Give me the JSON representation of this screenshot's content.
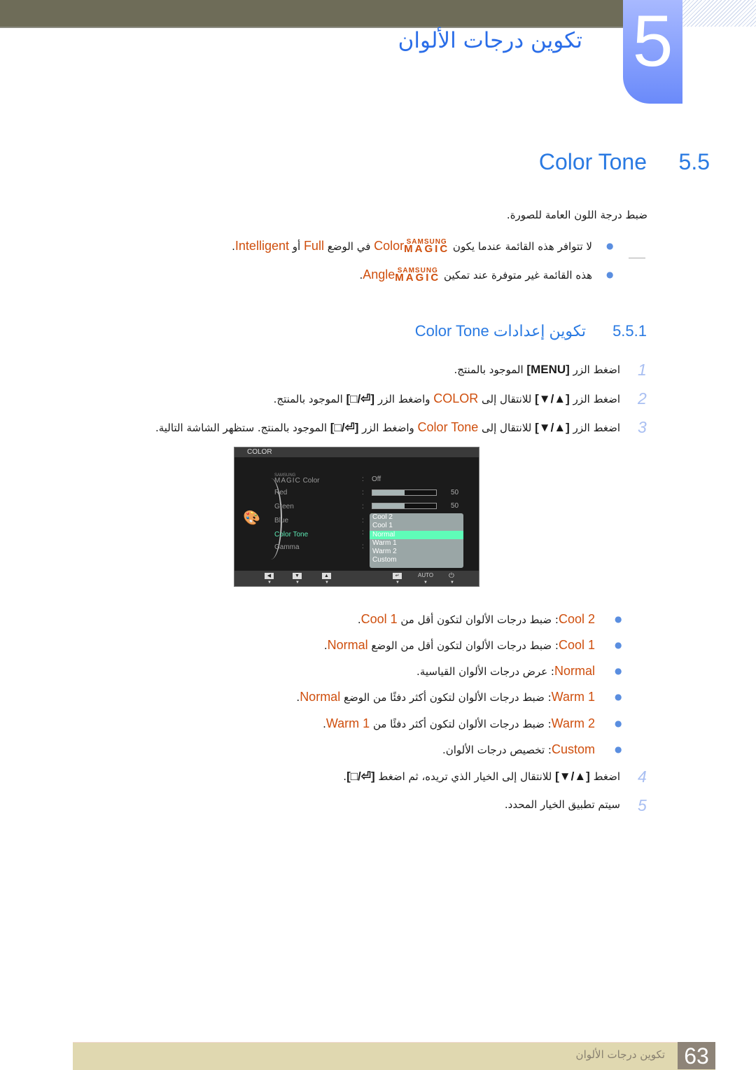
{
  "header": {
    "chapter_number": "5",
    "chapter_title": "تكوين درجات الألوان"
  },
  "section": {
    "number": "5.5",
    "title": "Color Tone"
  },
  "intro": "ضبط درجة اللون العامة للصورة.",
  "notes": [
    [
      {
        "t": "لا تتوافر هذه القائمة عندما يكون "
      },
      {
        "t": "SAMSUNG|MAGIC",
        "s": "magic"
      },
      {
        "t": "Color",
        "s": "accent"
      },
      {
        "t": " في الوضع "
      },
      {
        "t": "Full",
        "s": "accent"
      },
      {
        "t": " أو "
      },
      {
        "t": "Intelligent",
        "s": "accent"
      },
      {
        "t": "."
      }
    ],
    [
      {
        "t": "هذه القائمة غير متوفرة عند تمكين "
      },
      {
        "t": "SAMSUNG|MAGIC",
        "s": "magic"
      },
      {
        "t": "Angle",
        "s": "accent"
      },
      {
        "t": "."
      }
    ]
  ],
  "subsection": {
    "number": "5.5.1",
    "title": "تكوين إعدادات Color Tone"
  },
  "steps": [
    {
      "n": "1",
      "parts": [
        {
          "t": "اضغط الزر "
        },
        {
          "t": "[MENU]",
          "s": "key"
        },
        {
          "t": " الموجود بالمنتج."
        }
      ]
    },
    {
      "n": "2",
      "parts": [
        {
          "t": "اضغط الزر "
        },
        {
          "t": "[▲/▼]",
          "s": "key"
        },
        {
          "t": " للانتقال إلى "
        },
        {
          "t": "COLOR",
          "s": "accent"
        },
        {
          "t": " واضغط الزر "
        },
        {
          "t": "[⏎/□]",
          "s": "key"
        },
        {
          "t": " الموجود بالمنتج."
        }
      ]
    },
    {
      "n": "3",
      "parts": [
        {
          "t": "اضغط الزر "
        },
        {
          "t": "[▲/▼]",
          "s": "key"
        },
        {
          "t": " للانتقال إلى "
        },
        {
          "t": "Color Tone",
          "s": "accent"
        },
        {
          "t": " واضغط الزر "
        },
        {
          "t": "[⏎/□]",
          "s": "key"
        },
        {
          "t": " الموجود بالمنتج. ستظهر الشاشة التالية."
        }
      ]
    }
  ],
  "osd": {
    "title": "COLOR",
    "magic_small": "SAMSUNG",
    "magic_big": "MAGIC",
    "magic_label": "Color",
    "magic_value": "Off",
    "items": [
      "Red",
      "Green",
      "Blue",
      "Color Tone",
      "Gamma"
    ],
    "red_value": "50",
    "green_value": "50",
    "red_level": 0.5,
    "green_level": 0.5,
    "options": [
      "Cool 2",
      "Cool 1",
      "Normal",
      "Warm 1",
      "Warm 2",
      "Custom"
    ],
    "selected_option": "Normal",
    "buttons": {
      "left": "◀",
      "down": "▼",
      "up": "▲",
      "enter": "↵",
      "auto": "AUTO",
      "power": "⏻"
    },
    "colors": {
      "selected_text": "#5ce8b3",
      "selected_option_bg": "#5ffcb8"
    }
  },
  "options_desc": [
    [
      {
        "t": "Cool 2",
        "s": "accent"
      },
      {
        "t": ": ضبط درجات الألوان لتكون أقل من "
      },
      {
        "t": "Cool 1",
        "s": "accent"
      },
      {
        "t": "."
      }
    ],
    [
      {
        "t": "Cool 1",
        "s": "accent"
      },
      {
        "t": ": ضبط درجات الألوان لتكون أقل من الوضع "
      },
      {
        "t": "Normal",
        "s": "accent"
      },
      {
        "t": "."
      }
    ],
    [
      {
        "t": "Normal",
        "s": "accent"
      },
      {
        "t": ": عرض درجات الألوان القياسية."
      }
    ],
    [
      {
        "t": "Warm 1",
        "s": "accent"
      },
      {
        "t": ": ضبط درجات الألوان لتكون أكثر دفئًا من الوضع "
      },
      {
        "t": "Normal",
        "s": "accent"
      },
      {
        "t": "."
      }
    ],
    [
      {
        "t": "Warm 2",
        "s": "accent"
      },
      {
        "t": ": ضبط درجات الألوان لتكون أكثر دفئًا من "
      },
      {
        "t": "Warm 1",
        "s": "accent"
      },
      {
        "t": "."
      }
    ],
    [
      {
        "t": "Custom",
        "s": "accent"
      },
      {
        "t": ": تخصيص درجات الألوان."
      }
    ]
  ],
  "steps_after": [
    {
      "n": "4",
      "parts": [
        {
          "t": "اضغط "
        },
        {
          "t": "[▲/▼]",
          "s": "key"
        },
        {
          "t": " للانتقال إلى الخيار الذي تريده، ثم اضغط "
        },
        {
          "t": "[⏎/□]",
          "s": "key"
        },
        {
          "t": "."
        }
      ]
    },
    {
      "n": "5",
      "parts": [
        {
          "t": "سيتم تطبيق الخيار المحدد."
        }
      ]
    }
  ],
  "footer": {
    "title": "تكوين درجات الألوان",
    "page": "63"
  },
  "colors": {
    "heading": "#2a7ae2",
    "accent": "#cf4f0e",
    "bullet": "#5a8ee0",
    "step_number": "#a9bff2",
    "header_bar": "#6e6c58",
    "footer_bar": "#e0d8b0"
  }
}
